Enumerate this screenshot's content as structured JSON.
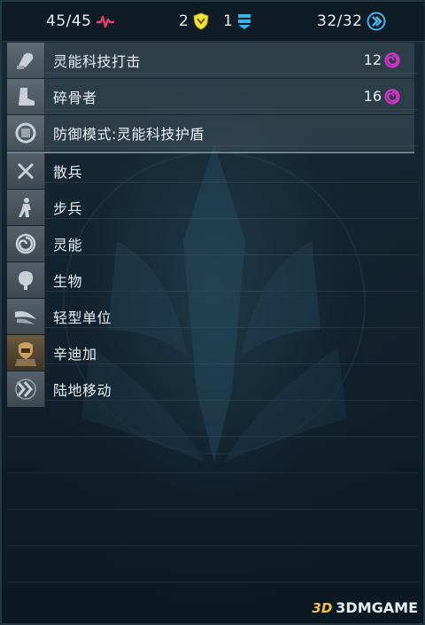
{
  "stats": {
    "health": "45/45",
    "armor": "2",
    "shield_armor": "1",
    "energy": "32/32"
  },
  "weapons": [
    {
      "label": "灵能科技打击",
      "value": "12",
      "icon": "psionic-fist-icon"
    },
    {
      "label": "碎骨者",
      "value": "16",
      "icon": "bonecrusher-boot-icon"
    }
  ],
  "abilities": [
    {
      "label": "防御模式:灵能科技护盾",
      "icon": "shield-mode-icon"
    }
  ],
  "attributes": [
    {
      "label": "散兵",
      "icon": "skirmisher-icon"
    },
    {
      "label": "步兵",
      "icon": "infantry-icon"
    },
    {
      "label": "灵能",
      "icon": "psionic-icon"
    },
    {
      "label": "生物",
      "icon": "biological-icon"
    },
    {
      "label": "轻型单位",
      "icon": "light-unit-icon"
    },
    {
      "label": "辛迪加",
      "icon": "syndicate-icon"
    },
    {
      "label": "陆地移动",
      "icon": "ground-movement-icon"
    }
  ],
  "watermark": {
    "logo": "3D",
    "text": "3DMGAME"
  },
  "colors": {
    "health_icon": "#e0406a",
    "armor_icon": "#f2e23a",
    "shield_icon": "#36b6e6",
    "energy_icon": "#4fb0ee",
    "psionic_damage_icon": "#d233c9",
    "divider": "#6f858f"
  }
}
